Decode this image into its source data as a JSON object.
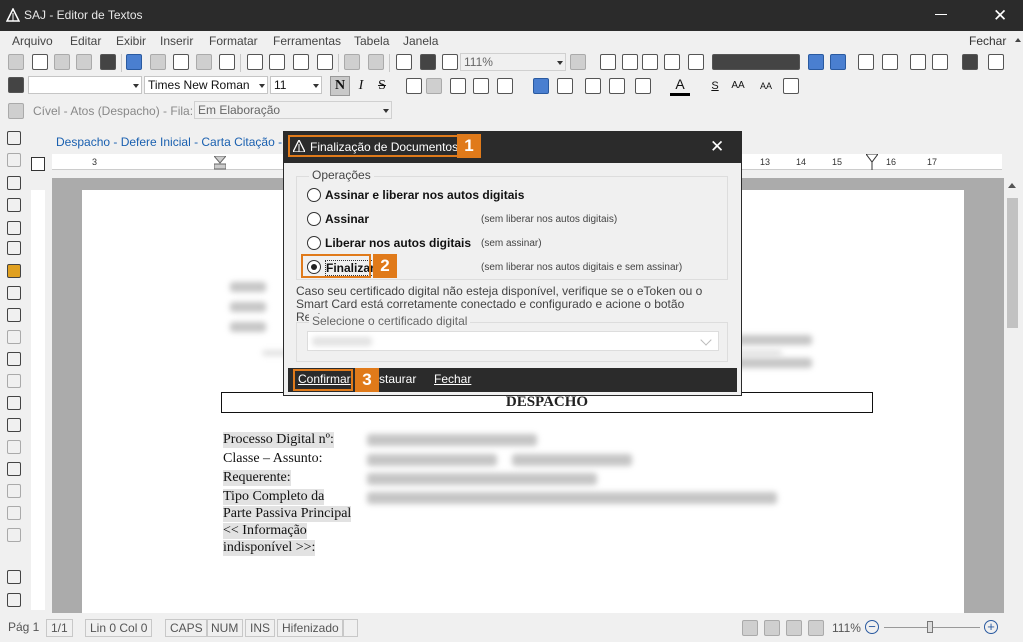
{
  "window": {
    "title": "SAJ - Editor de Textos"
  },
  "menu": {
    "items": [
      "Arquivo",
      "Editar",
      "Exibir",
      "Inserir",
      "Formatar",
      "Ferramentas",
      "Tabela",
      "Janela"
    ],
    "fechar": "Fechar"
  },
  "toolbar": {
    "zoom": "111%"
  },
  "format": {
    "font": "Times New Roman",
    "size": "11",
    "bold": "N",
    "italic": "I",
    "strike": "S",
    "underline": "S",
    "color_letter": "A",
    "grow": "AA",
    "shrink": "AA"
  },
  "context": {
    "label": "Cível - Atos (Despacho) - Fila:",
    "fila_value": "Em Elaboração"
  },
  "tab": {
    "label": "Despacho - Defere Inicial - Carta  Citação - Vi"
  },
  "ruler": {
    "labels": [
      "3",
      "13",
      "14",
      "15",
      "16",
      "17"
    ]
  },
  "document": {
    "heading": "DESPACHO",
    "labels": [
      "Processo Digital nº:",
      "Classe – Assunto:",
      "Requerente:",
      "Tipo Completo da",
      "Parte Passiva Principal",
      "<< Informação",
      "indisponível >>:"
    ]
  },
  "dialog": {
    "title": "Finalização de Documentos",
    "group_label": "Operações",
    "options": [
      {
        "label": "Assinar e liberar nos autos digitais",
        "note": "",
        "selected": false
      },
      {
        "label": "Assinar",
        "note": "(sem liberar nos autos digitais)",
        "selected": false
      },
      {
        "label": "Liberar nos autos digitais",
        "note": "(sem assinar)",
        "selected": false
      },
      {
        "label": "Finalizar",
        "note": "(sem liberar nos autos digitais e sem assinar)",
        "selected": true
      }
    ],
    "note": "Caso seu certificado digital não esteja disponível, verifique se o eToken ou o Smart Card está corretamente conectado e configurado e acione o botão Restaurar.",
    "cert_label": "Selecione o certificado digital",
    "buttons": {
      "confirm": "Confirmar",
      "restore": "staurar",
      "close": "Fechar"
    },
    "badges": [
      "1",
      "2",
      "3"
    ]
  },
  "status": {
    "page": "Pág 1",
    "pages": "1/1",
    "line_col": "Lin 0  Col 0",
    "caps": "CAPS",
    "num": "NUM",
    "ins": "INS",
    "hyphen": "Hifenizado",
    "zoom": "111%"
  },
  "colors": {
    "accent": "#e07a1a",
    "titlebar": "#2b2b2b",
    "link": "#1a60b0"
  },
  "icons": [
    "saj-logo-icon",
    "minimize-icon",
    "close-icon",
    "zoom-in-icon",
    "zoom-out-icon",
    "radio-icon"
  ]
}
